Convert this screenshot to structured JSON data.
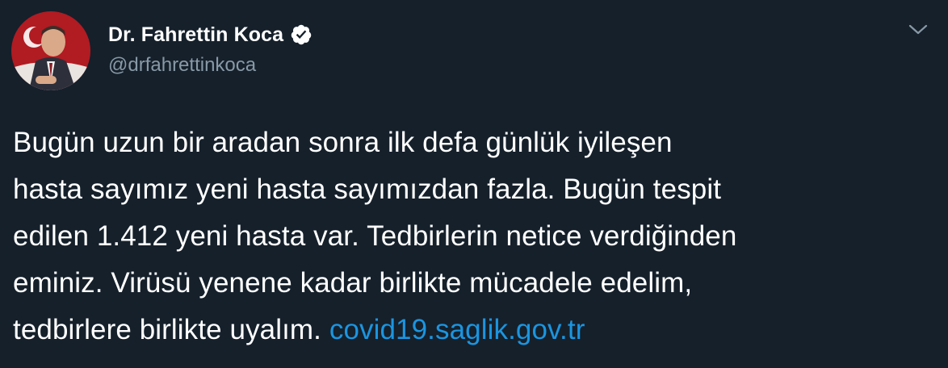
{
  "author": {
    "display_name": "Dr. Fahrettin Koca",
    "handle": "@drfahrettinkoca",
    "verified_icon": "verified-badge-icon"
  },
  "tweet": {
    "lines": [
      "Bugün uzun bir aradan sonra ilk defa günlük iyileşen",
      "hasta sayımız yeni hasta sayımızdan fazla. Bugün tespit",
      "edilen 1.412 yeni hasta var. Tedbirlerin netice verdiğinden",
      "eminiz. Virüsü yenene kadar birlikte mücadele edelim,"
    ],
    "last_line_text": "tedbirlere birlikte uyalım. ",
    "link_text": "covid19.saglik.gov.tr"
  },
  "menu_icon": "chevron-down-icon",
  "colors": {
    "background": "#15202b",
    "text": "#ffffff",
    "secondary": "#8899a6",
    "link": "#1b95e0"
  }
}
